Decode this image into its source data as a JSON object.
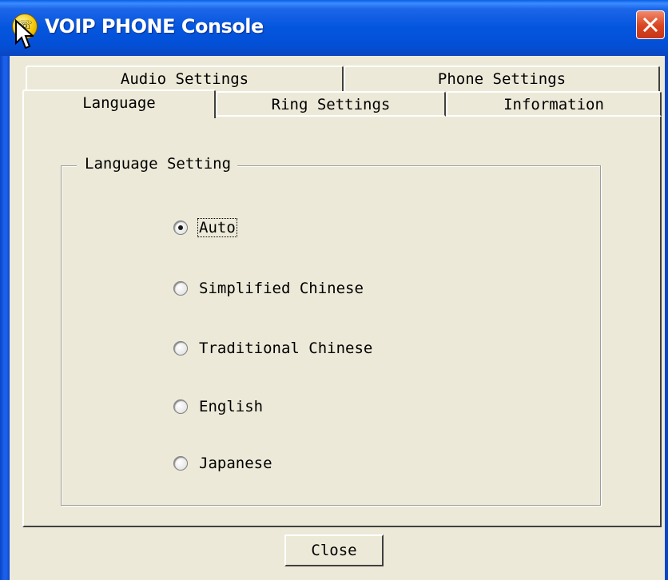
{
  "window": {
    "title": "VOIP PHONE Console"
  },
  "tabs": {
    "back_row": [
      {
        "label": "Audio Settings"
      },
      {
        "label": "Phone Settings"
      }
    ],
    "front_row": [
      {
        "label": "Language",
        "selected": true
      },
      {
        "label": "Ring Settings"
      },
      {
        "label": "Information"
      }
    ]
  },
  "language_group": {
    "label": "Language Setting",
    "options": [
      {
        "label": "Auto",
        "checked": true
      },
      {
        "label": "Simplified Chinese",
        "checked": false
      },
      {
        "label": "Traditional Chinese",
        "checked": false
      },
      {
        "label": "English",
        "checked": false
      },
      {
        "label": "Japanese",
        "checked": false
      }
    ]
  },
  "buttons": {
    "close_label": "Close"
  },
  "icons": {
    "app": "phone-app-icon",
    "window_close": "close-icon",
    "pointer": "mouse-cursor-icon"
  },
  "colors": {
    "titlebar": "#0455de",
    "window_bg": "#ece9d8",
    "close_button": "#d94421"
  }
}
